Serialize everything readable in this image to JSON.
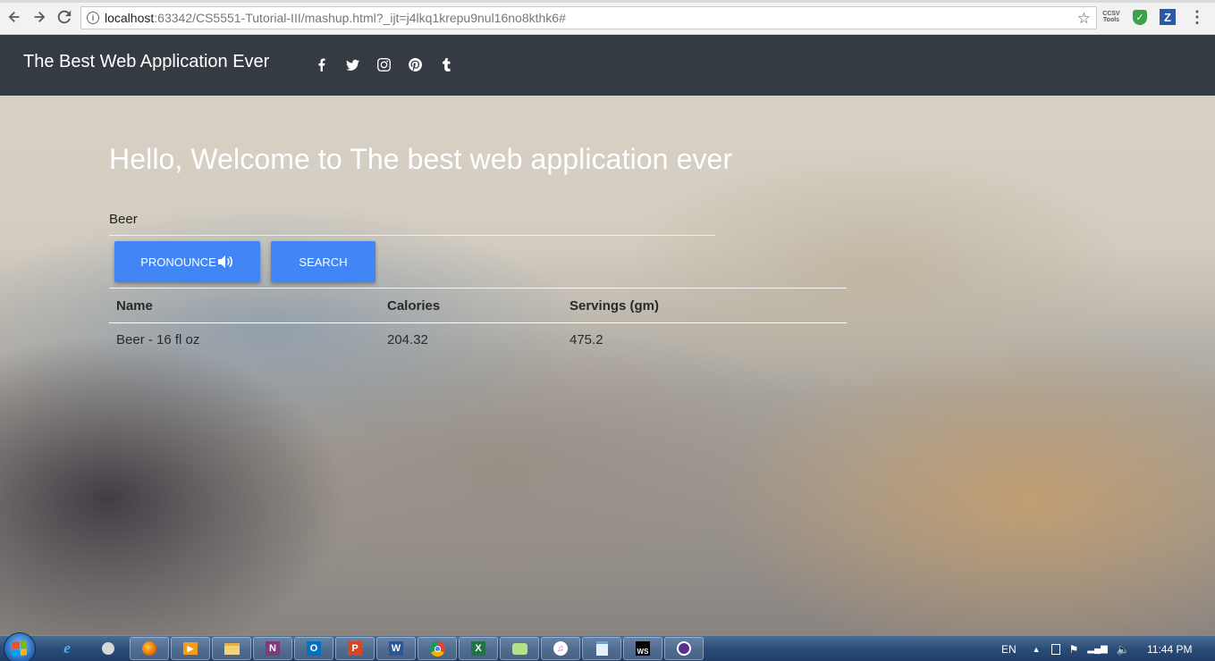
{
  "browser": {
    "url_host": "localhost",
    "url_rest": ":63342/CS5551-Tutorial-III/mashup.html?_ijt=j4lkq1krepu9nul16no8kthk6#"
  },
  "app": {
    "brand": "The Best Web Application Ever",
    "social_icons": [
      "facebook-icon",
      "twitter-icon",
      "instagram-icon",
      "pinterest-icon",
      "tumblr-icon"
    ],
    "welcome": "Hello, Welcome to The best web application ever",
    "search_value": "Beer",
    "pronounce_label": "PRONOUNCE",
    "search_label": "SEARCH",
    "table": {
      "headers": [
        "Name",
        "Calories",
        "Servings (gm)"
      ],
      "rows": [
        [
          "Beer - 16 fl oz",
          "204.32",
          "475.2"
        ]
      ]
    }
  },
  "taskbar": {
    "language": "EN",
    "clock": "11:44 PM"
  },
  "colors": {
    "navbar": "#353b42",
    "button": "#4285f4"
  }
}
